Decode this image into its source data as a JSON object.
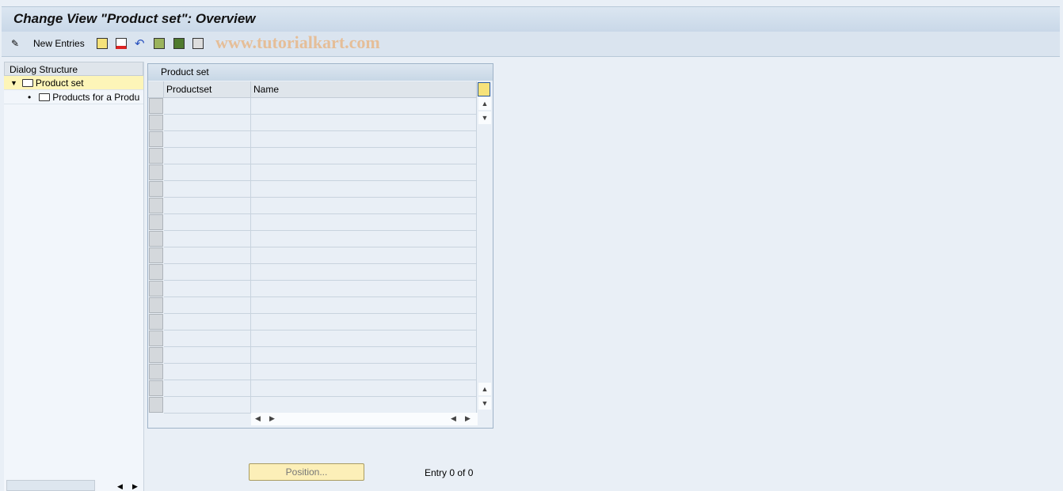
{
  "title": "Change View \"Product set\": Overview",
  "toolbar": {
    "new_entries": "New Entries",
    "watermark": "www.tutorialkart.com",
    "icons": [
      "edit-icon",
      "copy-icon",
      "delete-icon",
      "undo-icon",
      "select-all-icon",
      "select-block-icon",
      "deselect-all-icon"
    ]
  },
  "dialog": {
    "header": "Dialog Structure",
    "items": [
      {
        "label": "Product set",
        "selected": true
      },
      {
        "label": "Products for a Produ"
      }
    ]
  },
  "table": {
    "title": "Product set",
    "columns": [
      "Productset",
      "Name"
    ],
    "rows": []
  },
  "footer": {
    "position_button": "Position...",
    "entry_text": "Entry 0 of 0"
  }
}
